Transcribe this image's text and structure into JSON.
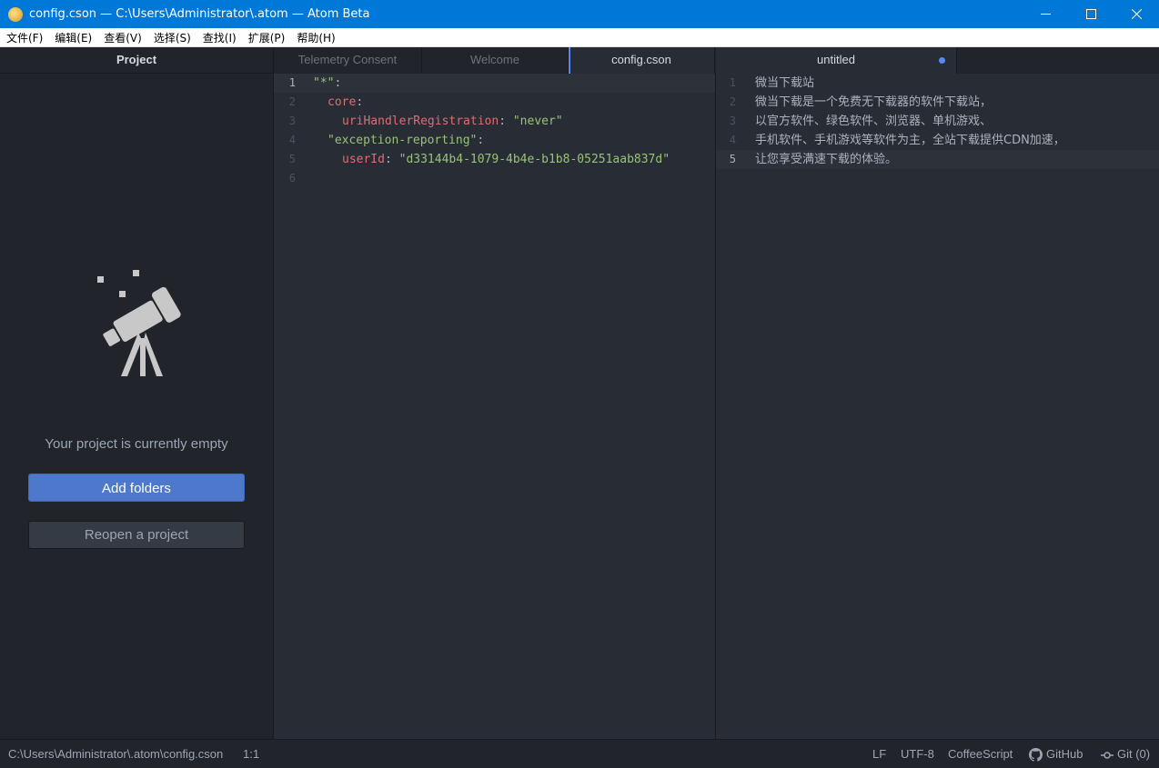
{
  "window": {
    "title": "config.cson — C:\\Users\\Administrator\\.atom — Atom Beta"
  },
  "menu": [
    "文件(F)",
    "编辑(E)",
    "查看(V)",
    "选择(S)",
    "查找(I)",
    "扩展(P)",
    "帮助(H)"
  ],
  "sidebar": {
    "title": "Project",
    "empty_message": "Your project is currently empty",
    "add_folders_label": "Add folders",
    "reopen_label": "Reopen a project",
    "icon": "telescope-icon"
  },
  "tabs_left": [
    {
      "label": "Telemetry Consent",
      "active": false
    },
    {
      "label": "Welcome",
      "active": false
    },
    {
      "label": "config.cson",
      "active": true
    }
  ],
  "tabs_right": [
    {
      "label": "untitled",
      "active": true,
      "modified": true
    }
  ],
  "editor_left": {
    "line_numbers": [
      "1",
      "2",
      "3",
      "4",
      "5",
      "6"
    ],
    "lines": {
      "l1_key": "\"*\"",
      "l1_colon": ":",
      "l2_key": "core",
      "l2_colon": ":",
      "l3_key": "uriHandlerRegistration",
      "l3_colon": ": ",
      "l3_value": "\"never\"",
      "l4_key": "\"exception-reporting\"",
      "l4_colon": ":",
      "l5_key": "userId",
      "l5_colon": ": ",
      "l5_value": "\"d33144b4-1079-4b4e-b1b8-05251aab837d\""
    }
  },
  "editor_right": {
    "line_numbers": [
      "1",
      "2",
      "3",
      "4",
      "5"
    ],
    "lines": [
      "微当下载站",
      "微当下载是一个免费无下载器的软件下载站，",
      "以官方软件、绿色软件、浏览器、单机游戏、",
      "手机软件、手机游戏等软件为主，全站下载提供CDN加速，",
      "让您享受满速下载的体验。"
    ]
  },
  "status": {
    "file_path": "C:\\Users\\Administrator\\.atom\\config.cson",
    "cursor": "1:1",
    "line_ending": "LF",
    "encoding": "UTF-8",
    "grammar": "CoffeeScript",
    "github": "GitHub",
    "git": "Git (0)"
  },
  "colors": {
    "accent": "#568af2",
    "button_primary": "#4d78cc",
    "titlebar": "#0078d7"
  }
}
